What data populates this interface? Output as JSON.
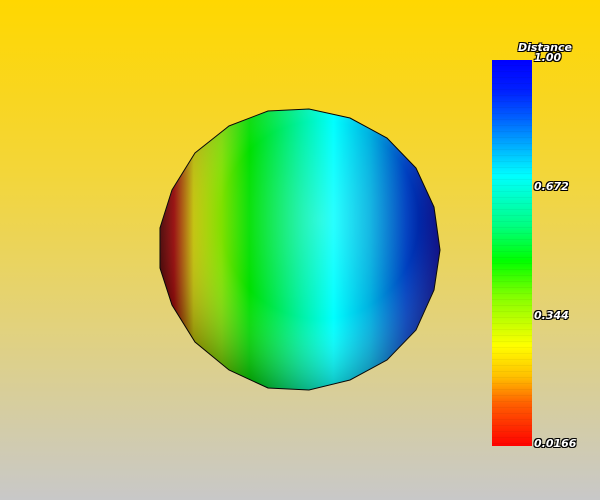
{
  "scalar_bar": {
    "title": "Distance",
    "labels": [
      "1.00",
      "0.672",
      "0.344",
      "0.0166"
    ]
  },
  "colors": {
    "background_top": "#ffd700",
    "background_bottom": "#c8c8c8"
  },
  "scene": {
    "object": "sphere",
    "colormap": "rainbow"
  }
}
